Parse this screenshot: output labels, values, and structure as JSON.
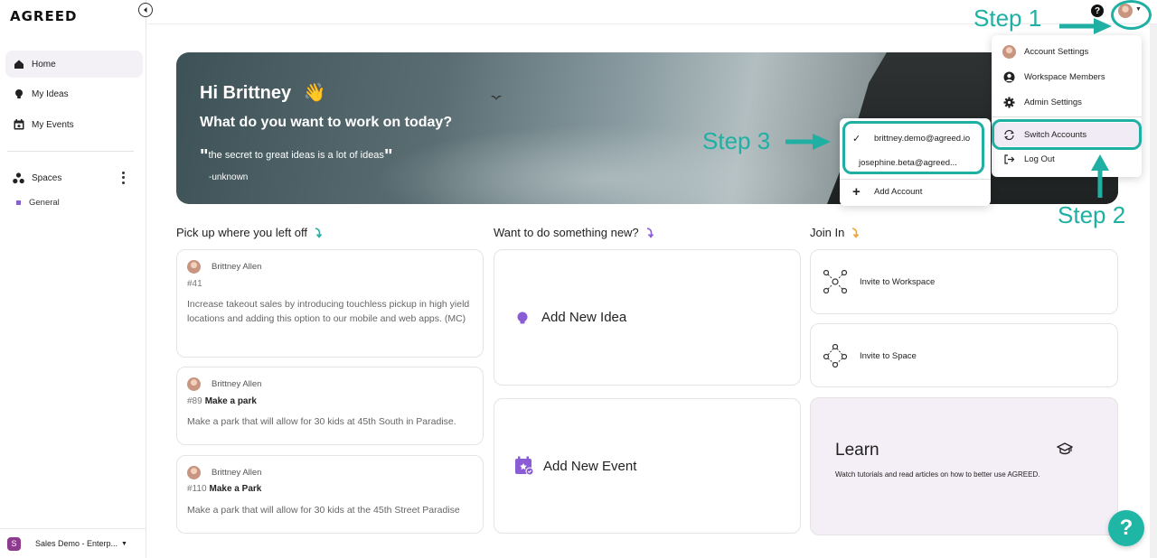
{
  "app": {
    "logo": "AGREED"
  },
  "sidebar": {
    "items": [
      {
        "label": "Home",
        "icon": "home-icon",
        "active": true
      },
      {
        "label": "My Ideas",
        "icon": "lightbulb-icon"
      },
      {
        "label": "My Events",
        "icon": "calendar-icon"
      }
    ],
    "spaces_label": "Spaces",
    "spaces": [
      {
        "label": "General",
        "color": "#8860d0"
      }
    ],
    "workspace": {
      "badge": "S",
      "name": "Sales Demo - Enterp...",
      "badge_color": "#8e3a8f"
    }
  },
  "topbar": {
    "help_label": "?"
  },
  "hero": {
    "greeting": "Hi Brittney",
    "emoji": "👋",
    "question": "What do you want to work on today?",
    "quote": "the secret to great ideas is a lot of ideas",
    "author": "-unknown"
  },
  "columns": {
    "pickup": "Pick up where you left off",
    "new": "Want to do something new?",
    "join": "Join In"
  },
  "recent_cards": [
    {
      "author": "Brittney Allen",
      "number": "#41",
      "title": "",
      "body": "Increase takeout sales by introducing touchless pickup in high yield locations and adding this option to our mobile and web apps. (MC)"
    },
    {
      "author": "Brittney Allen",
      "number": "#89",
      "title": "Make a park",
      "body": "Make a park that will allow for 30 kids at 45th South in Paradise."
    },
    {
      "author": "Brittney Allen",
      "number": "#110",
      "title": "Make a Park",
      "body": "Make a park that will allow for 30 kids at the 45th Street Paradise"
    }
  ],
  "actions": {
    "add_idea": "Add New Idea",
    "add_event": "Add New Event"
  },
  "join": {
    "invite_workspace": "Invite to Workspace",
    "invite_space": "Invite to Space"
  },
  "learn": {
    "title": "Learn",
    "description": "Watch tutorials and read articles on how to better use AGREED."
  },
  "account_menu": {
    "items": [
      "Account Settings",
      "Workspace Members",
      "Admin Settings",
      "Switch Accounts",
      "Log Out"
    ]
  },
  "switch_menu": {
    "accounts": [
      "brittney.demo@agreed.io",
      "josephine.beta@agreed..."
    ],
    "add_account": "Add Account"
  },
  "annotations": {
    "step1": "Step 1",
    "step2": "Step 2",
    "step3": "Step 3",
    "color": "#1fb0a3"
  },
  "help_float": "?"
}
